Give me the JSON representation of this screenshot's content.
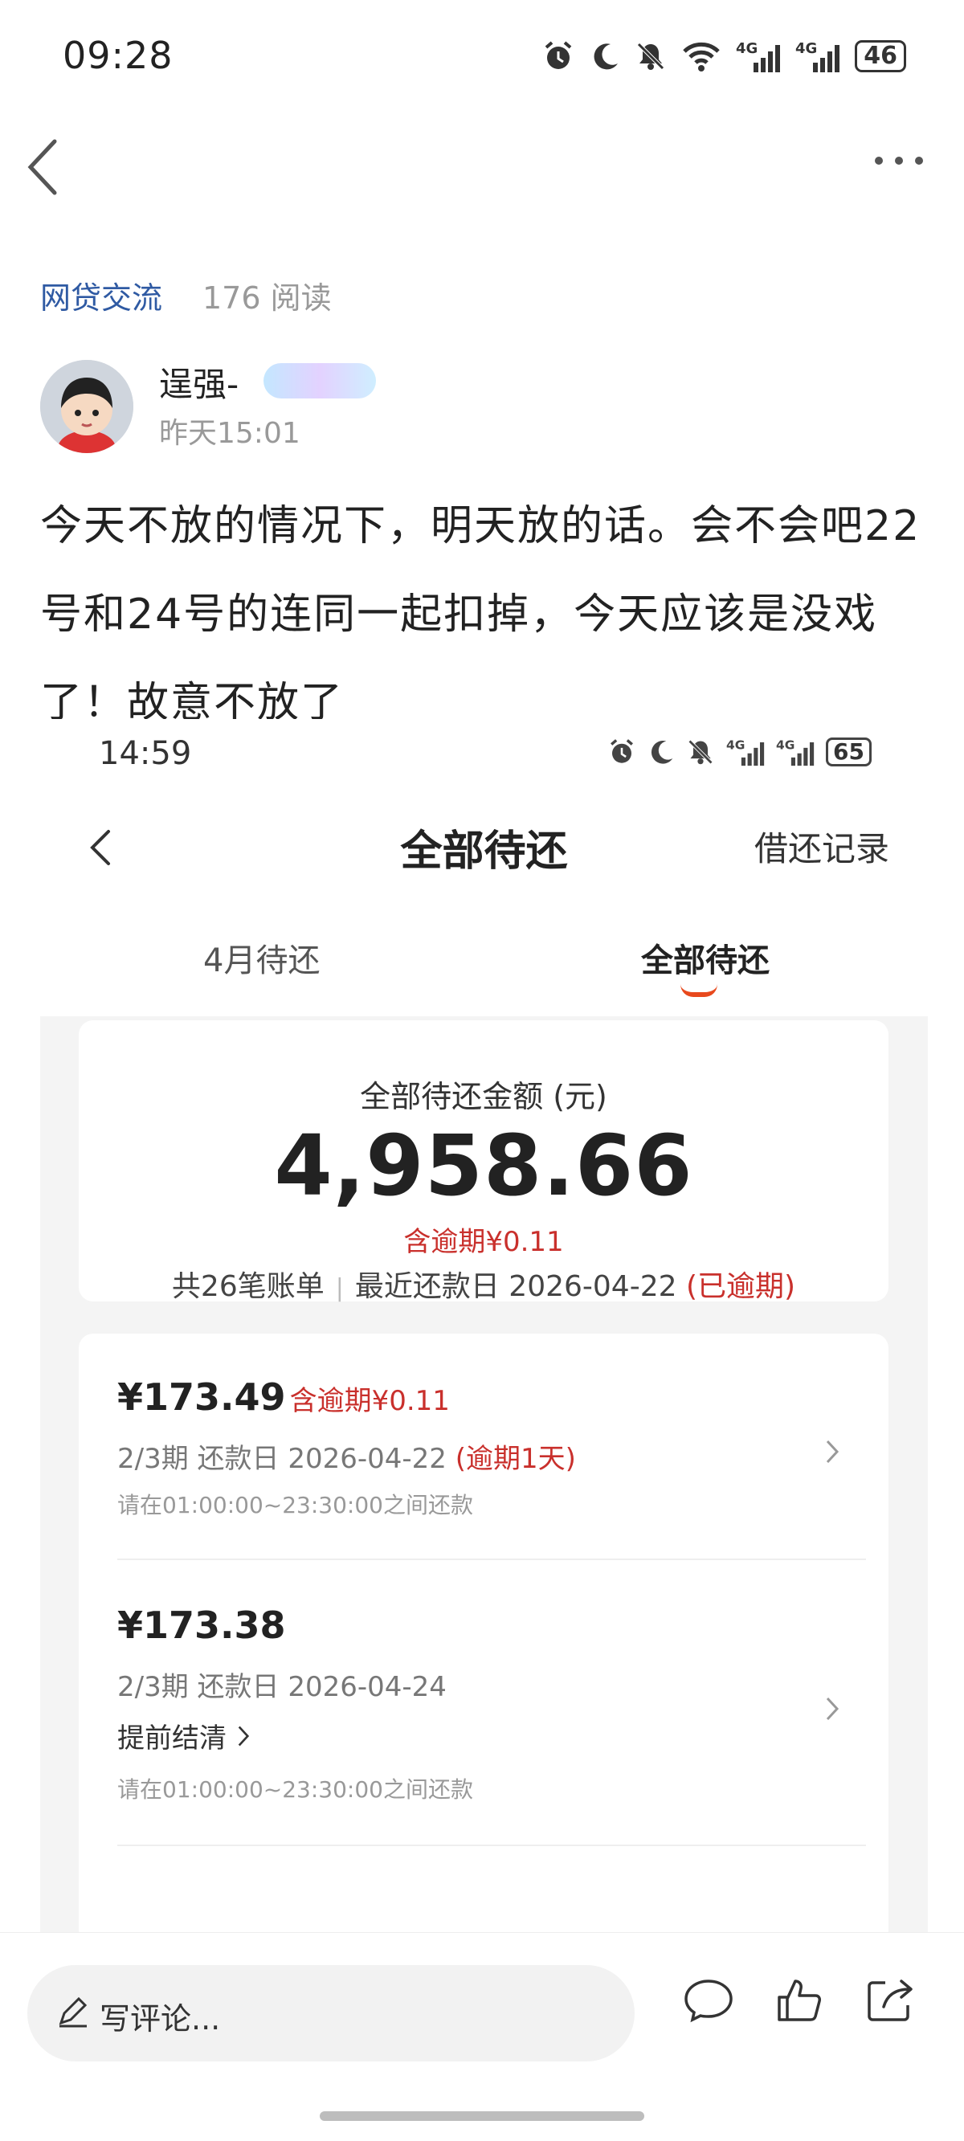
{
  "status_bar": {
    "time": "09:28",
    "battery": "46"
  },
  "post": {
    "forum": "网贷交流",
    "read_count": "176 阅读",
    "username": "逞强-",
    "time": "昨天15:01",
    "text": "今天不放的情况下，明天放的话。会不会吧22号和24号的连同一起扣掉，今天应该是没戏了！故意不放了"
  },
  "screenshot": {
    "status_time": "14:59",
    "battery": "65",
    "title": "全部待还",
    "record_link": "借还记录",
    "tabs": [
      {
        "label": "4月待还",
        "active": false
      },
      {
        "label": "全部待还",
        "active": true
      }
    ],
    "summary": {
      "label": "全部待还金额 (元)",
      "amount": "4,958.66",
      "overdue": "含逾期¥0.11",
      "count": "共26笔账单",
      "recent_due": "最近还款日 2026-04-22",
      "overdue_flag": "(已逾期)"
    },
    "bills": [
      {
        "amount": "¥173.49",
        "overdue": "含逾期¥0.11",
        "due": "2/3期 还款日 2026-04-22",
        "due_flag": "(逾期1天)",
        "hint": "请在01:00:00~23:30:00之间还款"
      },
      {
        "amount": "¥173.38",
        "due": "2/3期 还款日 2026-04-24",
        "early": "提前结清",
        "hint": "请在01:00:00~23:30:00之间还款"
      }
    ]
  },
  "bottom_bar": {
    "comment_placeholder": "写评论..."
  },
  "colors": {
    "link": "#2f5aa3",
    "overdue_red": "#c9302c",
    "accent": "#e8491d"
  }
}
